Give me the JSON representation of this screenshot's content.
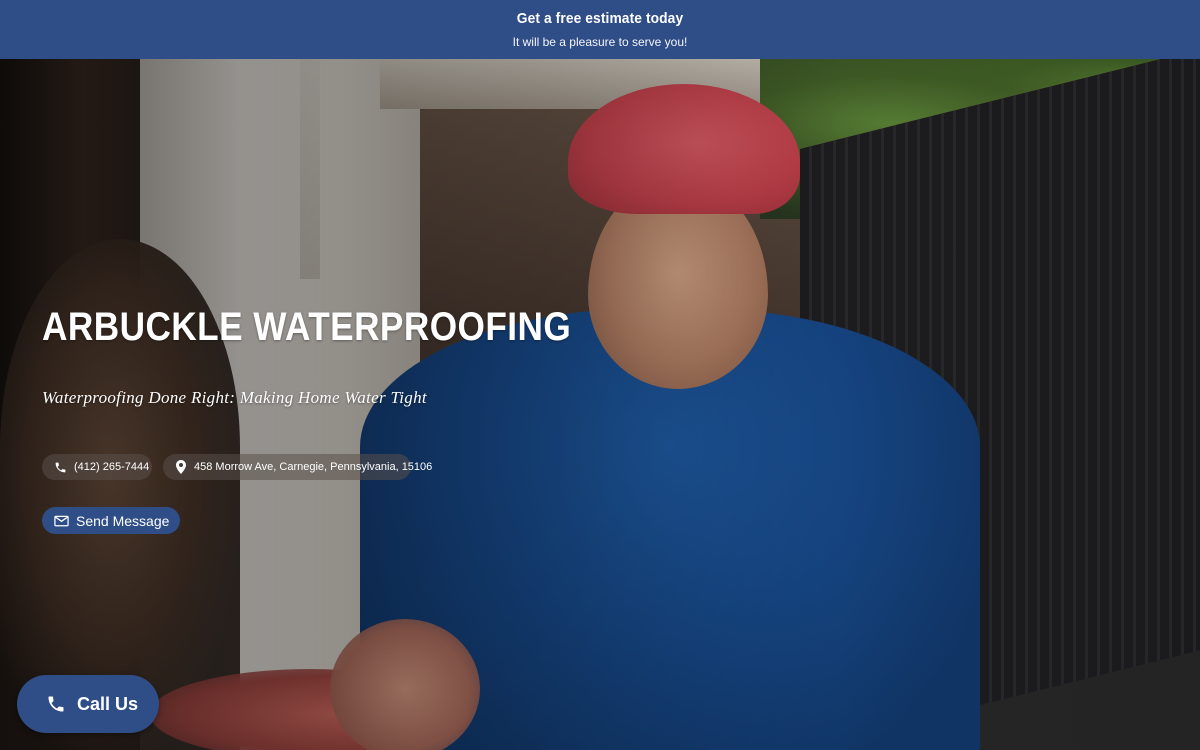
{
  "top_bar": {
    "title": "Get a free estimate today",
    "subtitle": "It will be a pleasure to serve you!"
  },
  "hero": {
    "brand_name": "ARBUCKLE WATERPROOFING",
    "tagline": "Waterproofing Done Right: Making Home Water Tight",
    "contact": {
      "phone": "(412) 265-7444",
      "phone_icon": "phone-icon",
      "address": "458 Morrow Ave, Carnegie, Pennsylvania, 15106",
      "address_icon": "map-pin-icon"
    },
    "send_message": {
      "label": "Send Message",
      "icon": "envelope-icon"
    }
  },
  "floating": {
    "call_us": {
      "label": "Call Us",
      "icon": "phone-icon"
    }
  },
  "colors": {
    "brand_blue": "#2f4d86",
    "text": "#ffffff"
  }
}
